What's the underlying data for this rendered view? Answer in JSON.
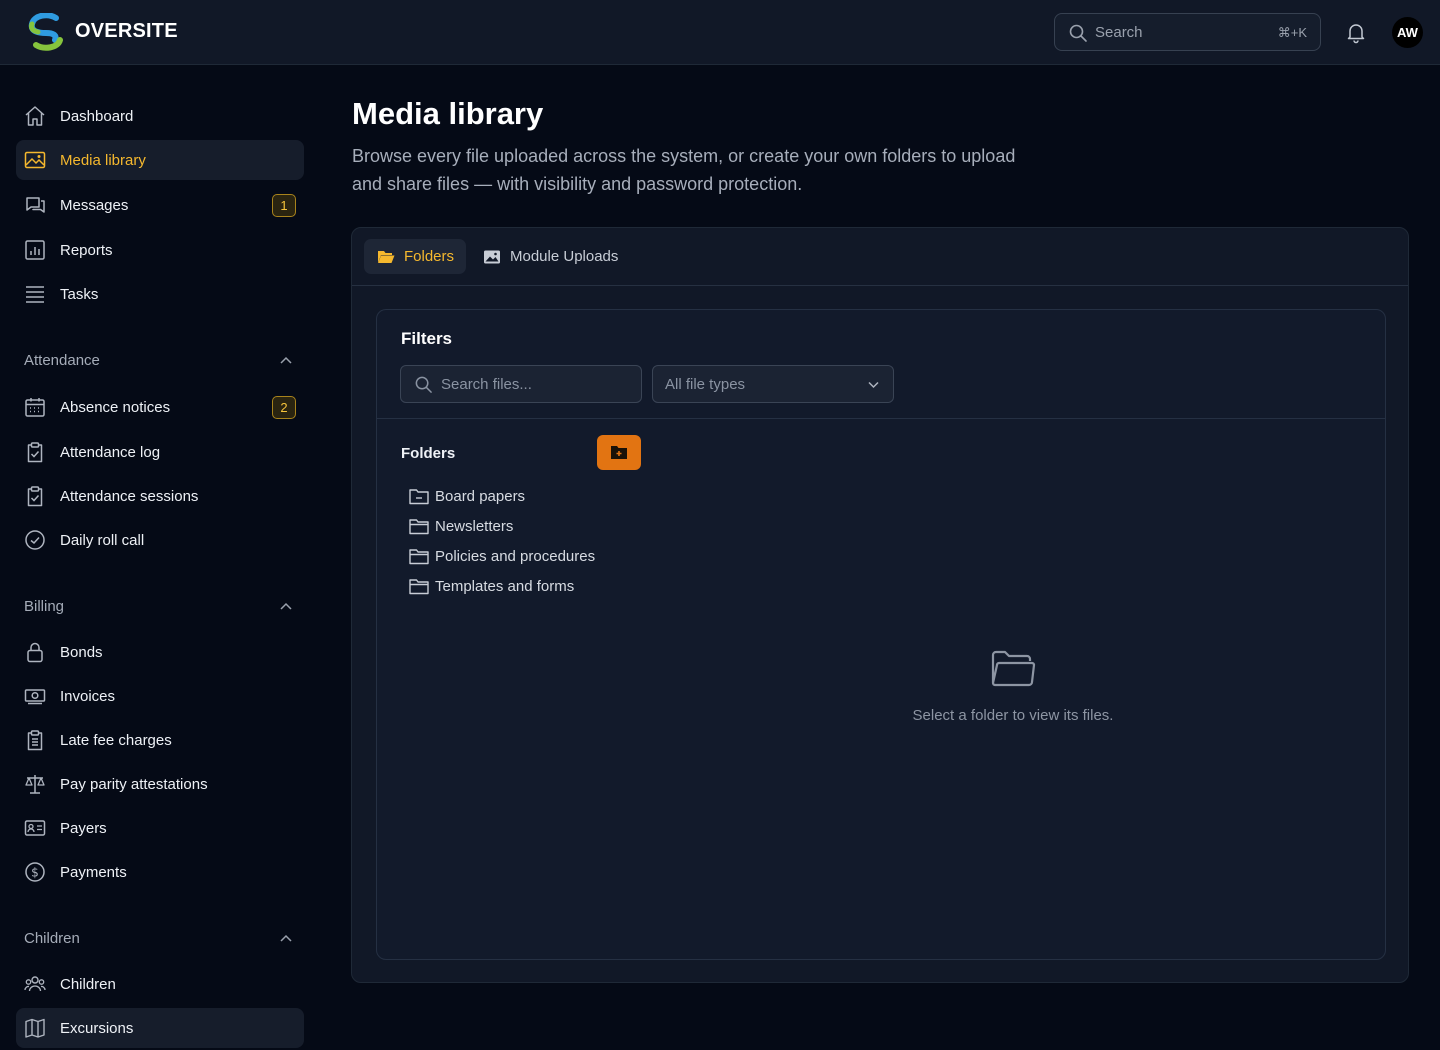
{
  "app": {
    "brand": "OVERSITE",
    "colors": {
      "accent": "#f5b82e",
      "primary_button": "#e27412",
      "background": "#050a16",
      "surface": "#111827"
    }
  },
  "header": {
    "search_placeholder": "Search",
    "search_shortcut": "⌘+K",
    "bell_icon": "bell-icon",
    "avatar_initials": "AW"
  },
  "sidebar": {
    "main_items": [
      {
        "label": "Dashboard",
        "icon": "home-icon"
      },
      {
        "label": "Media library",
        "icon": "image-icon",
        "active": true
      },
      {
        "label": "Messages",
        "icon": "chat-icon",
        "badge": "1"
      },
      {
        "label": "Reports",
        "icon": "chart-icon"
      },
      {
        "label": "Tasks",
        "icon": "list-icon"
      }
    ],
    "attendance": {
      "title": "Attendance",
      "items": [
        {
          "label": "Absence notices",
          "icon": "calendar-icon",
          "badge": "2"
        },
        {
          "label": "Attendance log",
          "icon": "clipboard-check-icon"
        },
        {
          "label": "Attendance sessions",
          "icon": "clipboard-check-icon"
        },
        {
          "label": "Daily roll call",
          "icon": "check-circle-icon"
        }
      ]
    },
    "billing": {
      "title": "Billing",
      "items": [
        {
          "label": "Bonds",
          "icon": "lock-icon"
        },
        {
          "label": "Invoices",
          "icon": "banknote-icon"
        },
        {
          "label": "Late fee charges",
          "icon": "clipboard-list-icon"
        },
        {
          "label": "Pay parity attestations",
          "icon": "scale-icon"
        },
        {
          "label": "Payers",
          "icon": "id-card-icon"
        },
        {
          "label": "Payments",
          "icon": "dollar-circle-icon"
        }
      ]
    },
    "children": {
      "title": "Children",
      "items": [
        {
          "label": "Children",
          "icon": "users-icon"
        },
        {
          "label": "Excursions",
          "icon": "map-icon"
        }
      ]
    }
  },
  "main": {
    "title": "Media library",
    "description": "Browse every file uploaded across the system, or create your own folders to upload and share files — with visibility and password protection.",
    "tabs": [
      {
        "label": "Folders",
        "icon": "folder-open-icon",
        "active": true
      },
      {
        "label": "Module Uploads",
        "icon": "image-icon"
      }
    ],
    "filters": {
      "title": "Filters",
      "search_placeholder": "Search files...",
      "file_type_selected": "All file types"
    },
    "folders": {
      "title": "Folders",
      "items": [
        {
          "label": "Board papers"
        },
        {
          "label": "Newsletters"
        },
        {
          "label": "Policies and procedures"
        },
        {
          "label": "Templates and forms"
        }
      ]
    },
    "empty_state": {
      "message": "Select a folder to view its files."
    }
  }
}
